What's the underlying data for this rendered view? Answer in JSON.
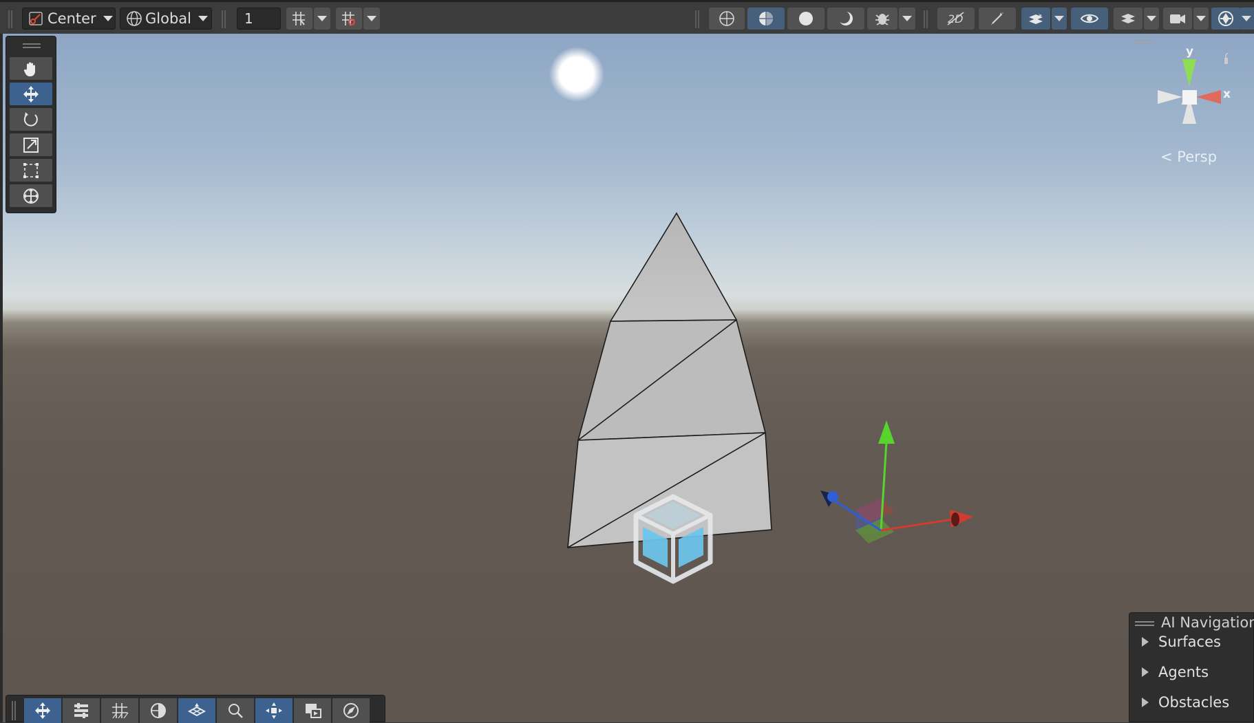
{
  "toolbar": {
    "pivot_mode": "Center",
    "pivot_rotation": "Global",
    "grid_snap_value": "1"
  },
  "scene_view": {
    "projection_label": "Persp",
    "gizmo_axes": {
      "x": "x",
      "y": "y"
    }
  },
  "ai_navigation": {
    "title": "AI Navigation",
    "items": [
      {
        "label": "Surfaces"
      },
      {
        "label": "Agents"
      },
      {
        "label": "Obstacles"
      }
    ]
  },
  "colors": {
    "active_button": "#46607c",
    "axis_x": "#d23b2e",
    "axis_y": "#62c42c",
    "axis_z": "#2f5fd6"
  }
}
